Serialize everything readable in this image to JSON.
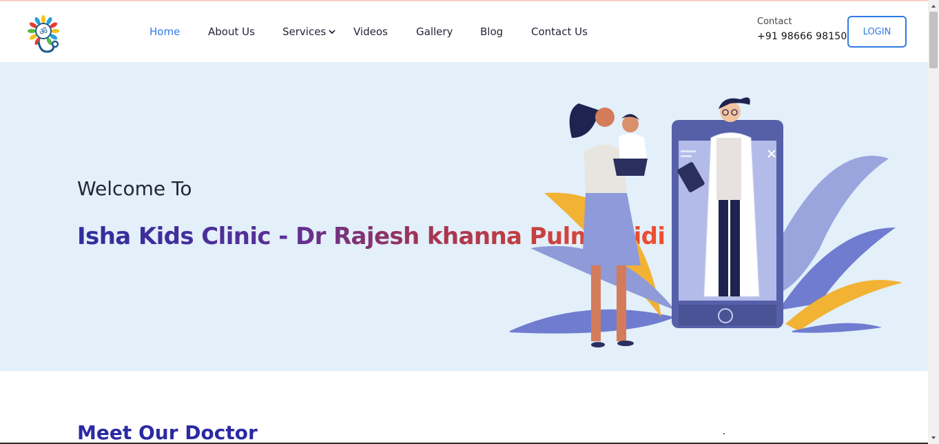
{
  "header": {
    "logo_icon": "isha-kids-clinic-logo",
    "nav": [
      {
        "label": "Home",
        "active": true
      },
      {
        "label": "About Us"
      },
      {
        "label": "Services"
      },
      {
        "label": "Videos"
      },
      {
        "label": "Gallery"
      },
      {
        "label": "Blog"
      },
      {
        "label": "Contact Us"
      }
    ],
    "contact_label": "Contact",
    "contact_phone": "+91 98666 98150",
    "login_label": "LOGIN"
  },
  "hero": {
    "welcome": "Welcome To",
    "title": "Isha Kids Clinic - Dr Rajesh khanna Pulmamidi",
    "illustration": "mother-child-doctor-illustration"
  },
  "section": {
    "heading": "Meet Our Doctor"
  },
  "colors": {
    "accent": "#2d7be5",
    "hero_bg": "#e3eff9",
    "heading_blue": "#2b2aa3",
    "gradient_start": "#2e2d9e",
    "gradient_end": "#f04f2e"
  }
}
